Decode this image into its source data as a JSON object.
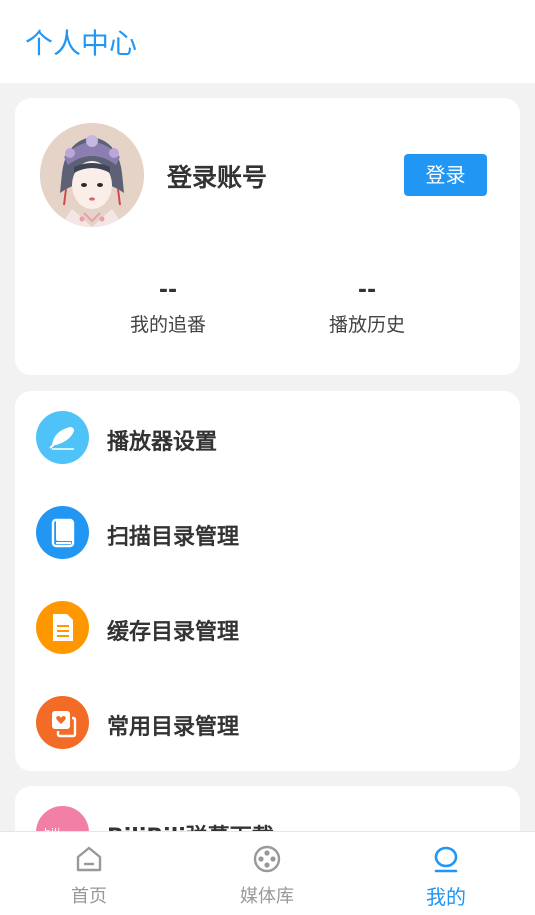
{
  "header": {
    "title": "个人中心"
  },
  "profile": {
    "login_title": "登录账号",
    "login_button": "登录",
    "stats": [
      {
        "value": "--",
        "label": "我的追番"
      },
      {
        "value": "--",
        "label": "播放历史"
      }
    ]
  },
  "menu": {
    "items": [
      {
        "label": "播放器设置",
        "icon": "feather-icon",
        "color": "#4fc3f7"
      },
      {
        "label": "扫描目录管理",
        "icon": "book-icon",
        "color": "#2196f3"
      },
      {
        "label": "缓存目录管理",
        "icon": "document-icon",
        "color": "#ff9800"
      },
      {
        "label": "常用目录管理",
        "icon": "heart-folder-icon",
        "color": "#f26b27"
      }
    ]
  },
  "extra": {
    "label": "BiliBili弹幕下载",
    "icon": "bilibili-icon",
    "color": "#f27fa6"
  },
  "tabbar": {
    "tabs": [
      {
        "label": "首页",
        "icon": "home-icon"
      },
      {
        "label": "媒体库",
        "icon": "film-reel-icon"
      },
      {
        "label": "我的",
        "icon": "person-icon",
        "active": true
      }
    ],
    "active_color": "#2196f3",
    "inactive_color": "#999999"
  }
}
